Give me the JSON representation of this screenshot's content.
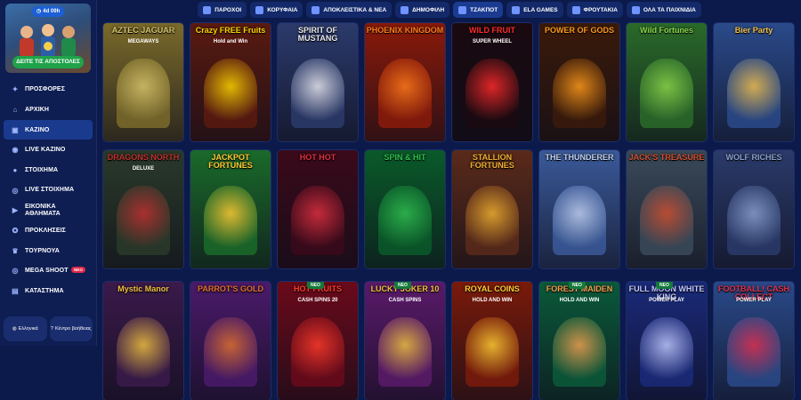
{
  "promo": {
    "timer": "4d 09h",
    "cta": "ΔΕΙΤΕ ΤΙΣ ΑΠΟΣΤΟΛΕΣ"
  },
  "nav": [
    {
      "label": "ΠΡΟΣΦΟΡΕΣ",
      "icon": "gift-icon"
    },
    {
      "label": "ΑΡΧΙΚΗ",
      "icon": "home-icon"
    },
    {
      "label": "ΚΑΖΙΝΟ",
      "icon": "slots-icon",
      "active": true
    },
    {
      "label": "LIVE ΚΑΖΙΝΟ",
      "icon": "live-casino-icon"
    },
    {
      "label": "ΣΤΟΙΧΗΜΑ",
      "icon": "soccer-ball-icon"
    },
    {
      "label": "LIVE ΣΤΟΙΧΗΜΑ",
      "icon": "live-bet-icon"
    },
    {
      "label": "ΕΙΚΟΝΙΚΑ ΑΘΛΗΜΑΤΑ",
      "icon": "virtual-sports-icon"
    },
    {
      "label": "ΠΡΟΚΛΗΣΕΙΣ",
      "icon": "challenges-icon"
    },
    {
      "label": "ΤΟΥΡΝΟΥΑ",
      "icon": "trophy-icon"
    },
    {
      "label": "MEGA SHOOT",
      "icon": "target-icon",
      "badge": "NEO"
    },
    {
      "label": "ΚΑΤΑΣΤΗΜΑ",
      "icon": "shop-icon"
    }
  ],
  "bottom": {
    "language": "Ελληνικά",
    "help": "Κέντρο βοήθειας"
  },
  "tabs": [
    {
      "label": "ΠΑΡΟΧΟΙ"
    },
    {
      "label": "ΚΟΡΥΦΑΙΑ"
    },
    {
      "label": "ΑΠΟΚΛΕΙΣΤΙΚΑ & ΝΕΑ"
    },
    {
      "label": "ΔΗΜΟΦΙΛΗ"
    },
    {
      "label": "ΤΖΑΚΠΟΤ",
      "active": true
    },
    {
      "label": "ELA GAMES"
    },
    {
      "label": "ΦΡΟΥΤΑΚΙΑ"
    },
    {
      "label": "ΟΛΑ ΤΑ ΠΑΙΧΝΙΔΙΑ"
    }
  ],
  "games": [
    {
      "title": "AZTEC JAGUAR",
      "sub": "MEGAWAYS",
      "bg": "#7a6a2a",
      "accent": "#d8c56b",
      "neo": ""
    },
    {
      "title": "Crazy FREE Fruits",
      "sub": "Hold and Win",
      "bg": "#5a1a10",
      "accent": "#ffd400",
      "neo": ""
    },
    {
      "title": "SPIRIT OF MUSTANG",
      "sub": "",
      "bg": "#2b3a6b",
      "accent": "#e8e8f0",
      "neo": ""
    },
    {
      "title": "PHOENIX KINGDOM",
      "sub": "",
      "bg": "#8a1a0a",
      "accent": "#ff7a1a",
      "neo": ""
    },
    {
      "title": "WILD FRUIT",
      "sub": "SUPER WHEEL",
      "bg": "#1a0a10",
      "accent": "#ff2a2a",
      "neo": ""
    },
    {
      "title": "POWER OF GODS",
      "sub": "",
      "bg": "#3a1a0a",
      "accent": "#ff9a1a",
      "neo": ""
    },
    {
      "title": "Wild Fortunes",
      "sub": "",
      "bg": "#2a6a2a",
      "accent": "#8bd64a",
      "neo": ""
    },
    {
      "title": "Bier Party",
      "sub": "",
      "bg": "#2a4a8a",
      "accent": "#f0c050",
      "neo": ""
    },
    {
      "title": "DRAGONS NORTH",
      "sub": "DELUXE",
      "bg": "#2a3a2a",
      "accent": "#c03030",
      "neo": ""
    },
    {
      "title": "JACKPOT FORTUNES",
      "sub": "",
      "bg": "#1a6a2a",
      "accent": "#ffcc33",
      "neo": ""
    },
    {
      "title": "HOT HOT",
      "sub": "",
      "bg": "#3a0a1a",
      "accent": "#e03040",
      "neo": ""
    },
    {
      "title": "SPIN & HIT",
      "sub": "",
      "bg": "#0a5a2a",
      "accent": "#30c050",
      "neo": ""
    },
    {
      "title": "STALLION FORTUNES",
      "sub": "",
      "bg": "#5a2a1a",
      "accent": "#f0b030",
      "neo": ""
    },
    {
      "title": "THE THUNDERER",
      "sub": "",
      "bg": "#3a5a9a",
      "accent": "#c0d0f0",
      "neo": ""
    },
    {
      "title": "JACK'S TREASURE",
      "sub": "",
      "bg": "#3a4a5a",
      "accent": "#d05030",
      "neo": ""
    },
    {
      "title": "WOLF RICHES",
      "sub": "",
      "bg": "#2a3a6a",
      "accent": "#8aa0d0",
      "neo": ""
    },
    {
      "title": "Mystic Manor",
      "sub": "",
      "bg": "#3a1a4a",
      "accent": "#f0c040",
      "neo": ""
    },
    {
      "title": "PARROT'S GOLD",
      "sub": "",
      "bg": "#4a1a6a",
      "accent": "#e07030",
      "neo": ""
    },
    {
      "title": "HOT FRUITS",
      "sub": "CASH SPINS 20",
      "bg": "#6a0a1a",
      "accent": "#ff3a2a",
      "neo": "NEO"
    },
    {
      "title": "LUCKY JOKER 10",
      "sub": "CASH SPINS",
      "bg": "#5a1a6a",
      "accent": "#f0c040",
      "neo": "NEO"
    },
    {
      "title": "ROYAL COINS",
      "sub": "HOLD AND WIN",
      "bg": "#7a1a0a",
      "accent": "#ffcc33",
      "neo": ""
    },
    {
      "title": "FOREST MAIDEN",
      "sub": "HOLD AND WIN",
      "bg": "#0a5a3a",
      "accent": "#f0a050",
      "neo": "NEO"
    },
    {
      "title": "FULL MOON WHITE KING",
      "sub": "POWER PLAY",
      "bg": "#1a2a7a",
      "accent": "#c0c8ff",
      "neo": "NEO"
    },
    {
      "title": "FOOTBALL! CASH COLLECT",
      "sub": "POWER PLAY",
      "bg": "#2a4a8a",
      "accent": "#e03050",
      "neo": ""
    }
  ]
}
